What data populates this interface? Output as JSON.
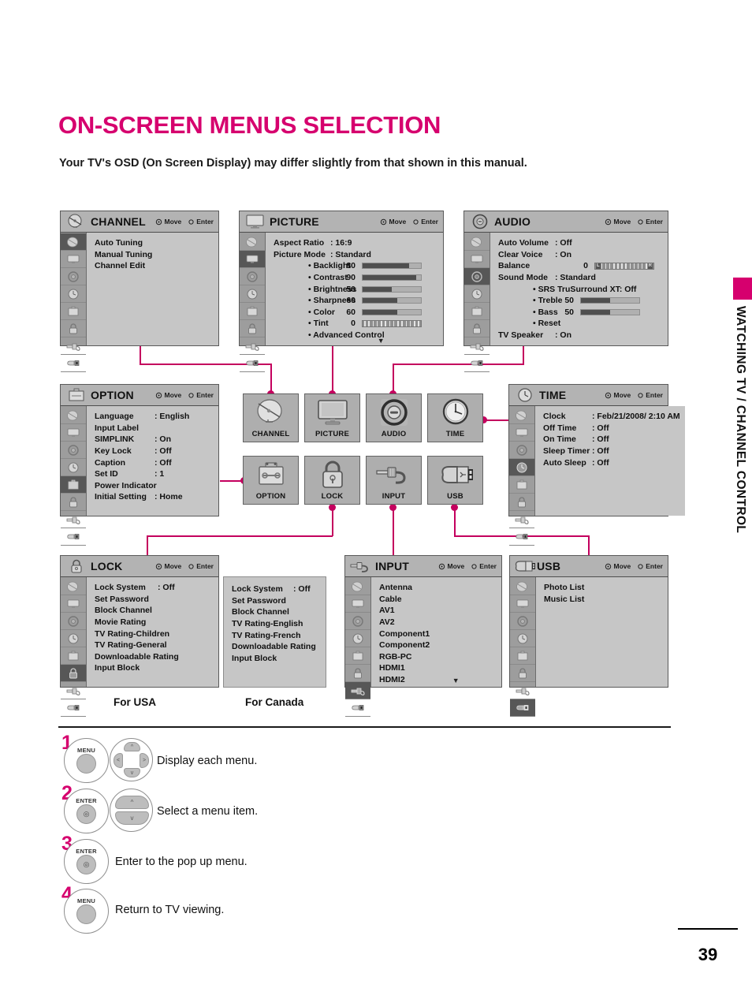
{
  "page": {
    "title": "ON-SCREEN MENUS SELECTION",
    "subtitle": "Your TV's OSD (On Screen Display) may differ slightly from that shown in this manual.",
    "side_tab": "WATCHING TV / CHANNEL CONTROL",
    "page_number": "39",
    "accent_color": "#d6006e",
    "wire_color": "#c4005e"
  },
  "hints": {
    "move": "Move",
    "enter": "Enter"
  },
  "menus": {
    "channel": {
      "title": "CHANNEL",
      "selected_rail": 0,
      "rows": [
        {
          "label": "Auto Tuning",
          "value": ""
        },
        {
          "label": "Manual Tuning",
          "value": ""
        },
        {
          "label": "Channel Edit",
          "value": ""
        }
      ]
    },
    "picture": {
      "title": "PICTURE",
      "selected_rail": 1,
      "rows": [
        {
          "label": "Aspect Ratio",
          "value": ": 16:9"
        },
        {
          "label": "Picture Mode",
          "value": ": Standard"
        }
      ],
      "sliders": [
        {
          "label": "• Backlight",
          "number": "80",
          "percent": 80
        },
        {
          "label": "• Contrast",
          "number": "90",
          "percent": 92
        },
        {
          "label": "• Brightness",
          "number": "50",
          "percent": 50
        },
        {
          "label": "• Sharpness",
          "number": "60",
          "percent": 60
        },
        {
          "label": "• Color",
          "number": "60",
          "percent": 60
        }
      ],
      "tint": {
        "label": "• Tint",
        "number": "0"
      },
      "advanced": "• Advanced Control",
      "more_caret": "▼"
    },
    "audio": {
      "title": "AUDIO",
      "selected_rail": 2,
      "rows": [
        {
          "label": "Auto Volume",
          "value": ": Off"
        },
        {
          "label": "Clear Voice",
          "value": ": On"
        }
      ],
      "balance": {
        "label": "Balance",
        "number": "0",
        "left_cap": "L",
        "right_cap": "R"
      },
      "sound_mode": {
        "label": "Sound Mode",
        "value": ": Standard"
      },
      "srs": "• SRS TruSurround XT:  Off",
      "sliders": [
        {
          "label": "• Treble",
          "number": "50",
          "percent": 50
        },
        {
          "label": "• Bass",
          "number": "50",
          "percent": 50
        }
      ],
      "reset": "• Reset",
      "tv_speaker": {
        "label": "TV Speaker",
        "value": ": On"
      }
    },
    "option": {
      "title": "OPTION",
      "selected_rail": 4,
      "rows": [
        {
          "label": "Language",
          "value": ": English"
        },
        {
          "label": "Input Label",
          "value": ""
        },
        {
          "label": "SIMPLINK",
          "value": ": On"
        },
        {
          "label": "Key Lock",
          "value": ": Off"
        },
        {
          "label": "Caption",
          "value": ": Off"
        },
        {
          "label": "Set ID",
          "value": ": 1"
        },
        {
          "label": "Power Indicator",
          "value": ""
        },
        {
          "label": "Initial Setting",
          "value": ": Home"
        }
      ]
    },
    "time": {
      "title": "TIME",
      "selected_rail": 3,
      "rows": [
        {
          "label": "Clock",
          "value": ": Feb/21/2008/  2:10 AM"
        },
        {
          "label": "Off Time",
          "value": ": Off"
        },
        {
          "label": "On Time",
          "value": ": Off"
        },
        {
          "label": "Sleep Timer",
          "value": ": Off"
        },
        {
          "label": "Auto Sleep",
          "value": ": Off"
        }
      ]
    },
    "lock": {
      "title": "LOCK",
      "selected_rail": 5,
      "rows": [
        {
          "label": "Lock System",
          "value": ": Off"
        },
        {
          "label": "Set Password",
          "value": ""
        },
        {
          "label": "Block Channel",
          "value": ""
        },
        {
          "label": "Movie Rating",
          "value": ""
        },
        {
          "label": "TV Rating-Children",
          "value": ""
        },
        {
          "label": "TV Rating-General",
          "value": ""
        },
        {
          "label": "Downloadable Rating",
          "value": ""
        },
        {
          "label": "Input Block",
          "value": ""
        }
      ]
    },
    "lock_canada": {
      "rows": [
        {
          "label": "Lock System",
          "value": ": Off"
        },
        {
          "label": "Set Password",
          "value": ""
        },
        {
          "label": "Block Channel",
          "value": ""
        },
        {
          "label": "TV Rating-English",
          "value": ""
        },
        {
          "label": "TV Rating-French",
          "value": ""
        },
        {
          "label": "Downloadable Rating",
          "value": ""
        },
        {
          "label": "Input Block",
          "value": ""
        }
      ]
    },
    "input": {
      "title": "INPUT",
      "selected_rail": 6,
      "rows": [
        {
          "label": "Antenna",
          "value": ""
        },
        {
          "label": "Cable",
          "value": ""
        },
        {
          "label": "AV1",
          "value": ""
        },
        {
          "label": "AV2",
          "value": ""
        },
        {
          "label": "Component1",
          "value": ""
        },
        {
          "label": "Component2",
          "value": ""
        },
        {
          "label": "RGB-PC",
          "value": ""
        },
        {
          "label": "HDMI1",
          "value": ""
        },
        {
          "label": "HDMI2",
          "value": ""
        }
      ],
      "more_caret": "▼"
    },
    "usb": {
      "title": "USB",
      "selected_rail": 7,
      "rows": [
        {
          "label": "Photo List",
          "value": ""
        },
        {
          "label": "Music List",
          "value": ""
        }
      ]
    }
  },
  "icon_grid": [
    {
      "name": "CHANNEL",
      "icon": "satellite-dish-icon"
    },
    {
      "name": "PICTURE",
      "icon": "monitor-icon"
    },
    {
      "name": "AUDIO",
      "icon": "speaker-icon"
    },
    {
      "name": "TIME",
      "icon": "clock-icon"
    },
    {
      "name": "OPTION",
      "icon": "toolbox-icon"
    },
    {
      "name": "LOCK",
      "icon": "padlock-icon"
    },
    {
      "name": "INPUT",
      "icon": "plug-icon"
    },
    {
      "name": "USB",
      "icon": "usb-icon"
    }
  ],
  "region_captions": {
    "usa": "For USA",
    "canada": "For Canada"
  },
  "steps": [
    {
      "num": "1",
      "button": "MENU",
      "control": "nav-pad",
      "text": "Display each menu."
    },
    {
      "num": "2",
      "button": "ENTER",
      "control": "up-down",
      "text": "Select a menu item."
    },
    {
      "num": "3",
      "button": "ENTER",
      "control": "none",
      "text": "Enter to the pop up menu."
    },
    {
      "num": "4",
      "button": "MENU",
      "control": "none",
      "text": "Return to TV viewing."
    }
  ]
}
